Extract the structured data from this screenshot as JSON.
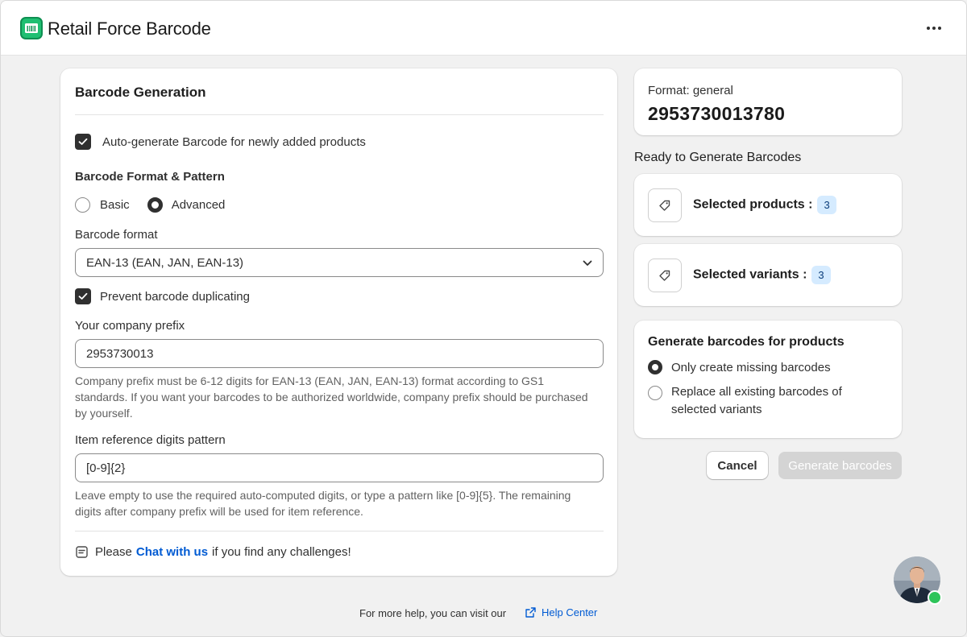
{
  "app": {
    "title": "Retail Force Barcode",
    "logo_icon": "barcode-cart-icon",
    "more_icon": "more-horizontal-icon"
  },
  "barcode_generation": {
    "title": "Barcode Generation",
    "auto_generate_label": "Auto-generate Barcode for newly added products",
    "auto_generate_checked": true,
    "format_pattern_title": "Barcode Format & Pattern",
    "mode_options": [
      "Basic",
      "Advanced"
    ],
    "mode_selected": "Advanced",
    "barcode_format_label": "Barcode format",
    "barcode_format_value": "EAN-13 (EAN, JAN, EAN-13)",
    "prevent_duplicate_label": "Prevent barcode duplicating",
    "prevent_duplicate_checked": true,
    "company_prefix_label": "Your company prefix",
    "company_prefix_value": "2953730013",
    "company_prefix_help": "Company prefix must be 6-12 digits for EAN-13 (EAN, JAN, EAN-13) format according to GS1 standards. If you want your barcodes to be authorized worldwide, company prefix should be purchased by yourself.",
    "item_ref_label": "Item reference digits pattern",
    "item_ref_value": "[0-9]{2}",
    "item_ref_help": "Leave empty to use the required auto-computed digits, or type a pattern like [0-9]{5}. The remaining digits after company prefix will be used for item reference.",
    "chat_prefix": "Please",
    "chat_link": "Chat with us",
    "chat_suffix": "if you find any challenges!"
  },
  "preview": {
    "format_label": "Format: general",
    "barcode_number": "2953730013780"
  },
  "ready": {
    "title": "Ready to Generate Barcodes",
    "selected_products_label": "Selected products :",
    "selected_products_count": "3",
    "selected_variants_label": "Selected variants :",
    "selected_variants_count": "3"
  },
  "generate_for": {
    "title": "Generate barcodes for products",
    "options": [
      "Only create missing barcodes",
      "Replace all existing barcodes of selected variants"
    ],
    "selected_index": 0
  },
  "actions": {
    "cancel_label": "Cancel",
    "generate_label": "Generate barcodes"
  },
  "footer": {
    "text": "For more help, you can visit our",
    "link": "Help Center"
  },
  "colors": {
    "accent_link": "#005bd3",
    "badge_bg": "#d5ebff",
    "logo_green": "#1fbf72",
    "online_green": "#2ec45a"
  }
}
